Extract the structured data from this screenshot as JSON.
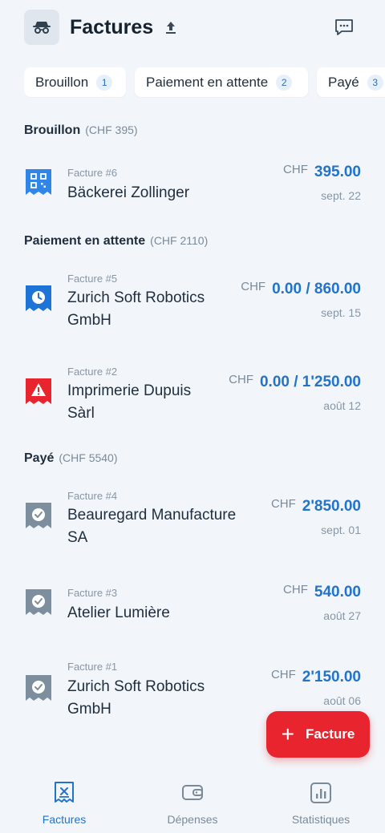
{
  "header": {
    "title": "Factures"
  },
  "filters": [
    {
      "label": "Brouillon",
      "count": "1"
    },
    {
      "label": "Paiement en attente",
      "count": "2"
    },
    {
      "label": "Payé",
      "count": "3"
    }
  ],
  "sections": {
    "draft": {
      "title": "Brouillon",
      "total": "(CHF 395)"
    },
    "pending": {
      "title": "Paiement en attente",
      "total": "(CHF 2110)"
    },
    "paid": {
      "title": "Payé",
      "total": "(CHF 5540)"
    }
  },
  "invoices": [
    {
      "number": "Facture #6",
      "client": "Bäckerei Zollinger",
      "currency": "CHF",
      "amount": "395.00",
      "date": "sept. 22",
      "icon": "qr-code-icon"
    },
    {
      "number": "Facture #5",
      "client": "Zurich Soft Robotics GmbH",
      "currency": "CHF",
      "amount": "0.00 / 860.00",
      "date": "sept. 15",
      "icon": "clock-icon"
    },
    {
      "number": "Facture #2",
      "client": "Imprimerie Dupuis Sàrl",
      "currency": "CHF",
      "amount": "0.00 / 1'250.00",
      "date": "août 12",
      "icon": "warning-icon"
    },
    {
      "number": "Facture #4",
      "client": "Beauregard Manufacture SA",
      "currency": "CHF",
      "amount": "2'850.00",
      "date": "sept. 01",
      "icon": "check-icon"
    },
    {
      "number": "Facture #3",
      "client": "Atelier Lumière",
      "currency": "CHF",
      "amount": "540.00",
      "date": "août 27",
      "icon": "check-icon"
    },
    {
      "number": "Facture #1",
      "client": "Zurich Soft Robotics GmbH",
      "currency": "CHF",
      "amount": "2'150.00",
      "date": "août 06",
      "icon": "check-icon"
    }
  ],
  "fab": {
    "label": "Facture",
    "icon": "plus-icon"
  },
  "nav": [
    {
      "label": "Factures",
      "icon": "invoice-icon",
      "active": true
    },
    {
      "label": "Dépenses",
      "icon": "wallet-icon",
      "active": false
    },
    {
      "label": "Statistiques",
      "icon": "chart-icon",
      "active": false
    }
  ],
  "colors": {
    "accent": "#2273c9",
    "danger": "#e8242e",
    "paid": "#7d8e9e",
    "background": "#f2f6fa"
  }
}
